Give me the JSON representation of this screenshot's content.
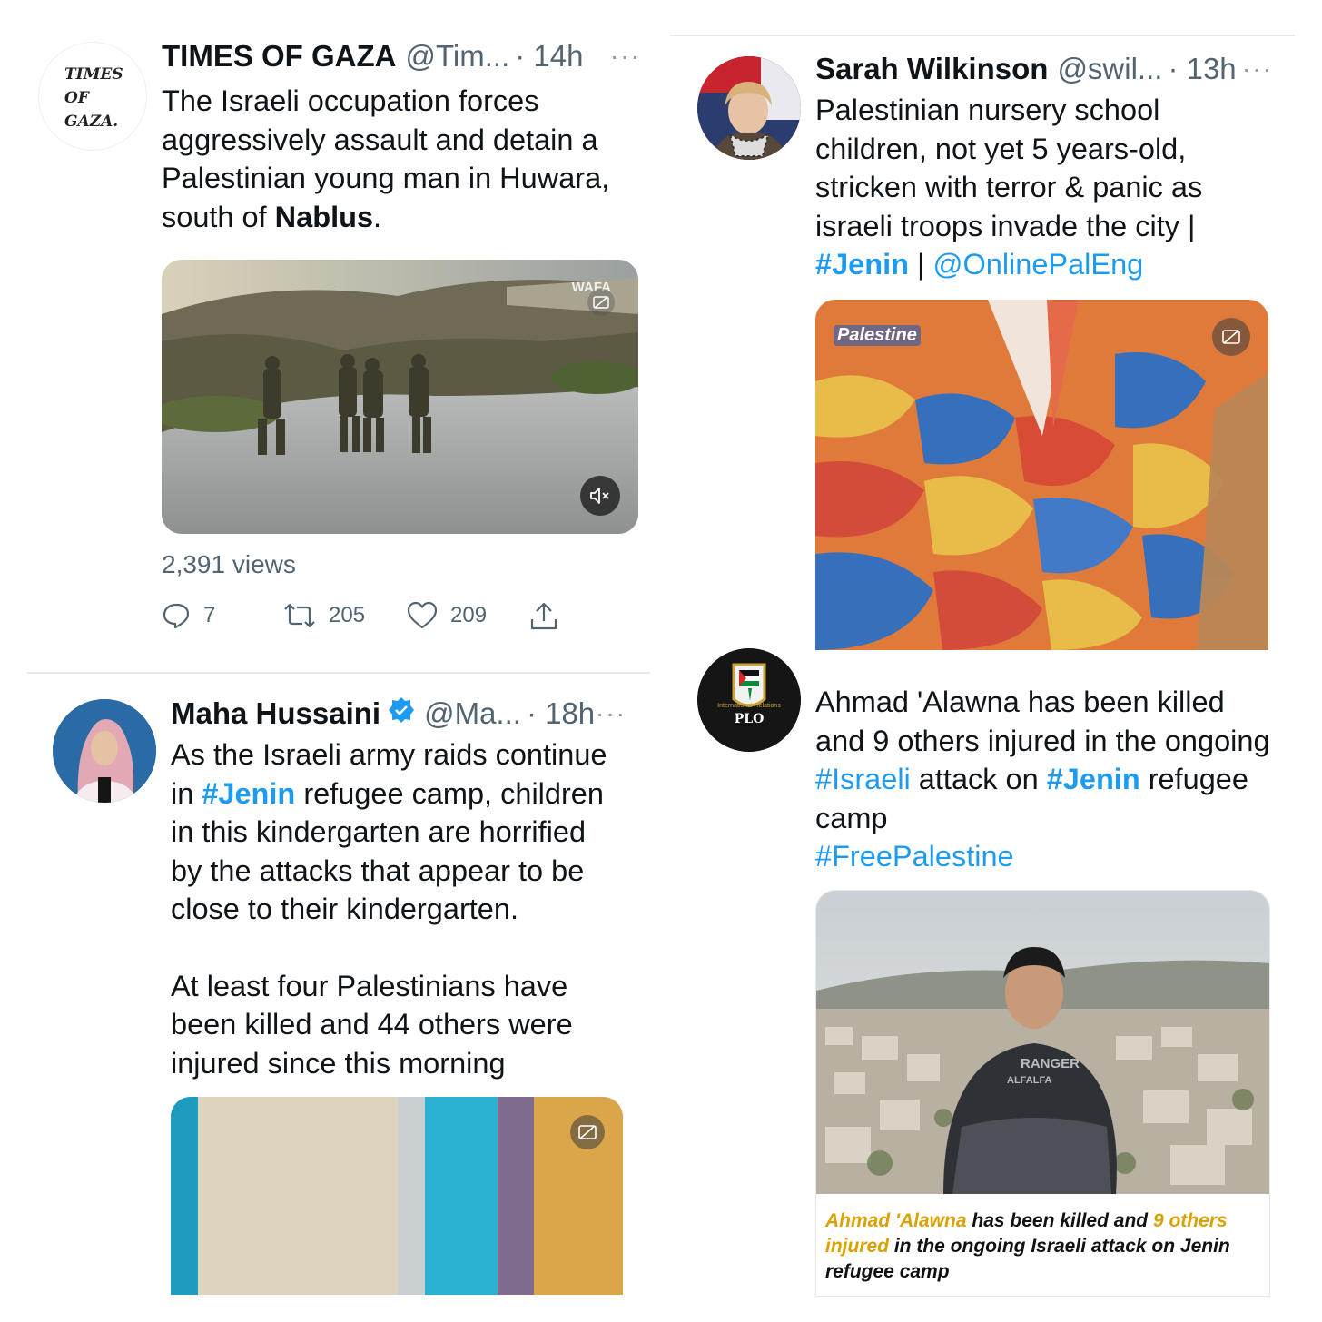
{
  "tweets": {
    "t1": {
      "avatar_text": "TIMES OF GAZA.",
      "name": "TIMES OF GAZA",
      "handle": "@Tim...",
      "time": "· 14h",
      "more": "···",
      "text_a": "The Israeli occupation forces aggressively assault and detain a Palestinian young man in Huwara, south of ",
      "text_bold": "Nablus",
      "text_b": ".",
      "views": "2,391 views",
      "replies": "7",
      "retweets": "205",
      "likes": "209",
      "watermark": "WAFA"
    },
    "t2": {
      "name": "Sarah Wilkinson",
      "handle": "@swil...",
      "time": "· 13h",
      "more": "···",
      "text": "Palestinian nursery school children, not yet 5 years-old, stricken with terror & panic as israeli troops invade the city |",
      "hashtag": "#Jenin",
      "sep": "|",
      "mention": "@OnlinePalEng",
      "media_label": "Palestine"
    },
    "t3": {
      "name": "Maha Hussaini",
      "handle": "@Ma...",
      "time": "· 18h",
      "more": "···",
      "p1_a": "As the Israeli army raids continue in ",
      "p1_tag": "#Jenin",
      "p1_b": " refugee camp, children in this kindergarten are horrified by the attacks that appear to be close to their kindergarten.",
      "p2": "At least four Palestinians have been killed and 44 others were injured since this morning"
    },
    "t4": {
      "avatar_small": "International Relations",
      "avatar_plo": "PLO",
      "text_a": "Ahmad 'Alawna has been killed and 9 others injured in the ongoing ",
      "tag1": "#Israeli",
      "text_b": " attack on ",
      "tag2": "#Jenin",
      "text_c": " refugee camp",
      "tag3": "#FreePalestine",
      "shirt": "RANGER ALFALFA",
      "caption_y1": "Ahmad 'Alawna",
      "caption_1": " has been killed and ",
      "caption_y2": "9 others injured",
      "caption_2": " in the ongoing Israeli attack on Jenin refugee camp"
    }
  }
}
